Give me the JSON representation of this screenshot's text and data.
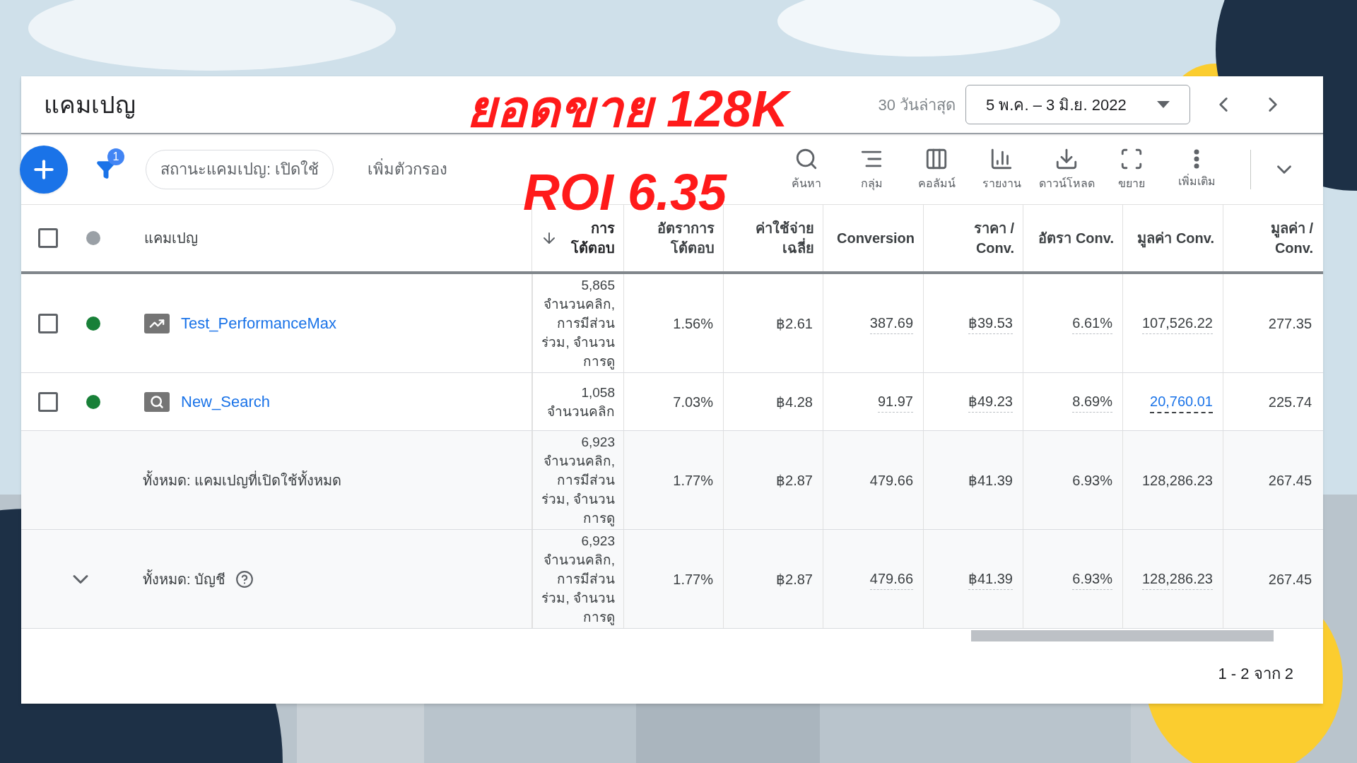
{
  "title": "แคมเปญ",
  "overlay": [
    "ยอดขาย 128K",
    "ROI 6.35"
  ],
  "date_range": {
    "label": "30 วันล่าสุด",
    "value": "5 พ.ค. – 3 มิ.ย. 2022"
  },
  "filter_badge": "1",
  "filter_chip": "สถานะแคมเปญ: เปิดใช้",
  "add_filter": "เพิ่มตัวกรอง",
  "toolbar": [
    {
      "kind": "search",
      "label": "ค้นหา"
    },
    {
      "kind": "segment",
      "label": "กลุ่ม"
    },
    {
      "kind": "columns",
      "label": "คอลัมน์"
    },
    {
      "kind": "reports",
      "label": "รายงาน"
    },
    {
      "kind": "download",
      "label": "ดาวน์โหลด"
    },
    {
      "kind": "expand",
      "label": "ขยาย"
    },
    {
      "kind": "more",
      "label": "เพิ่มเติม"
    }
  ],
  "table": {
    "header_checkbox": {
      "checked": false
    },
    "header_status": {
      "color": "#9aa0a6"
    },
    "columns": [
      {
        "label": "แคมเปญ",
        "sorted": false
      },
      {
        "label": "การ โต้ตอบ",
        "sorted": true
      },
      {
        "label": "อัตราการ โต้ตอบ",
        "sorted": false
      },
      {
        "label": "ค่าใช้จ่าย เฉลี่ย",
        "sorted": false
      },
      {
        "label": "Conversion",
        "sorted": false
      },
      {
        "label": "ราคา / Conv.",
        "sorted": false
      },
      {
        "label": "อัตรา Conv.",
        "sorted": false
      },
      {
        "label": "มูลค่า Conv.",
        "sorted": false
      },
      {
        "label": "มูลค่า / Conv.",
        "sorted": false
      }
    ],
    "rows": [
      {
        "kind": "performance",
        "checked": false,
        "color": "#188038",
        "name": "Test_PerformanceMax",
        "interactions": "5,865",
        "interaction_types": "จำนวนคลิก, การมีส่วนร่วม, จำนวนการดู",
        "values": [
          "1.56%",
          "฿2.61",
          "387.69",
          "฿39.53",
          "6.61%",
          "107,526.22",
          "277.35"
        ],
        "underlined": true,
        "value_link": false
      },
      {
        "kind": "search",
        "checked": false,
        "color": "#188038",
        "name": "New_Search",
        "interactions": "1,058",
        "interaction_types": "จำนวนคลิก",
        "values": [
          "7.03%",
          "฿4.28",
          "91.97",
          "฿49.23",
          "8.69%",
          "20,760.01",
          "225.74"
        ],
        "underlined": true,
        "value_link": true
      },
      {
        "kind": "total",
        "expandable": false,
        "name": "ทั้งหมด: แคมเปญที่เปิดใช้ทั้งหมด",
        "help": false,
        "interactions": "6,923",
        "interaction_types": "จำนวนคลิก, การมีส่วนร่วม, จำนวนการดู",
        "values": [
          "1.77%",
          "฿2.87",
          "479.66",
          "฿41.39",
          "6.93%",
          "128,286.23",
          "267.45"
        ],
        "underlined": false,
        "value_link": false
      },
      {
        "kind": "total",
        "expandable": true,
        "name": "ทั้งหมด: บัญชี",
        "help": true,
        "interactions": "6,923",
        "interaction_types": "จำนวนคลิก, การมีส่วนร่วม, จำนวนการดู",
        "values": [
          "1.77%",
          "฿2.87",
          "479.66",
          "฿41.39",
          "6.93%",
          "128,286.23",
          "267.45"
        ],
        "underlined": true,
        "value_link": false
      }
    ]
  },
  "pagination": "1 - 2 จาก 2"
}
